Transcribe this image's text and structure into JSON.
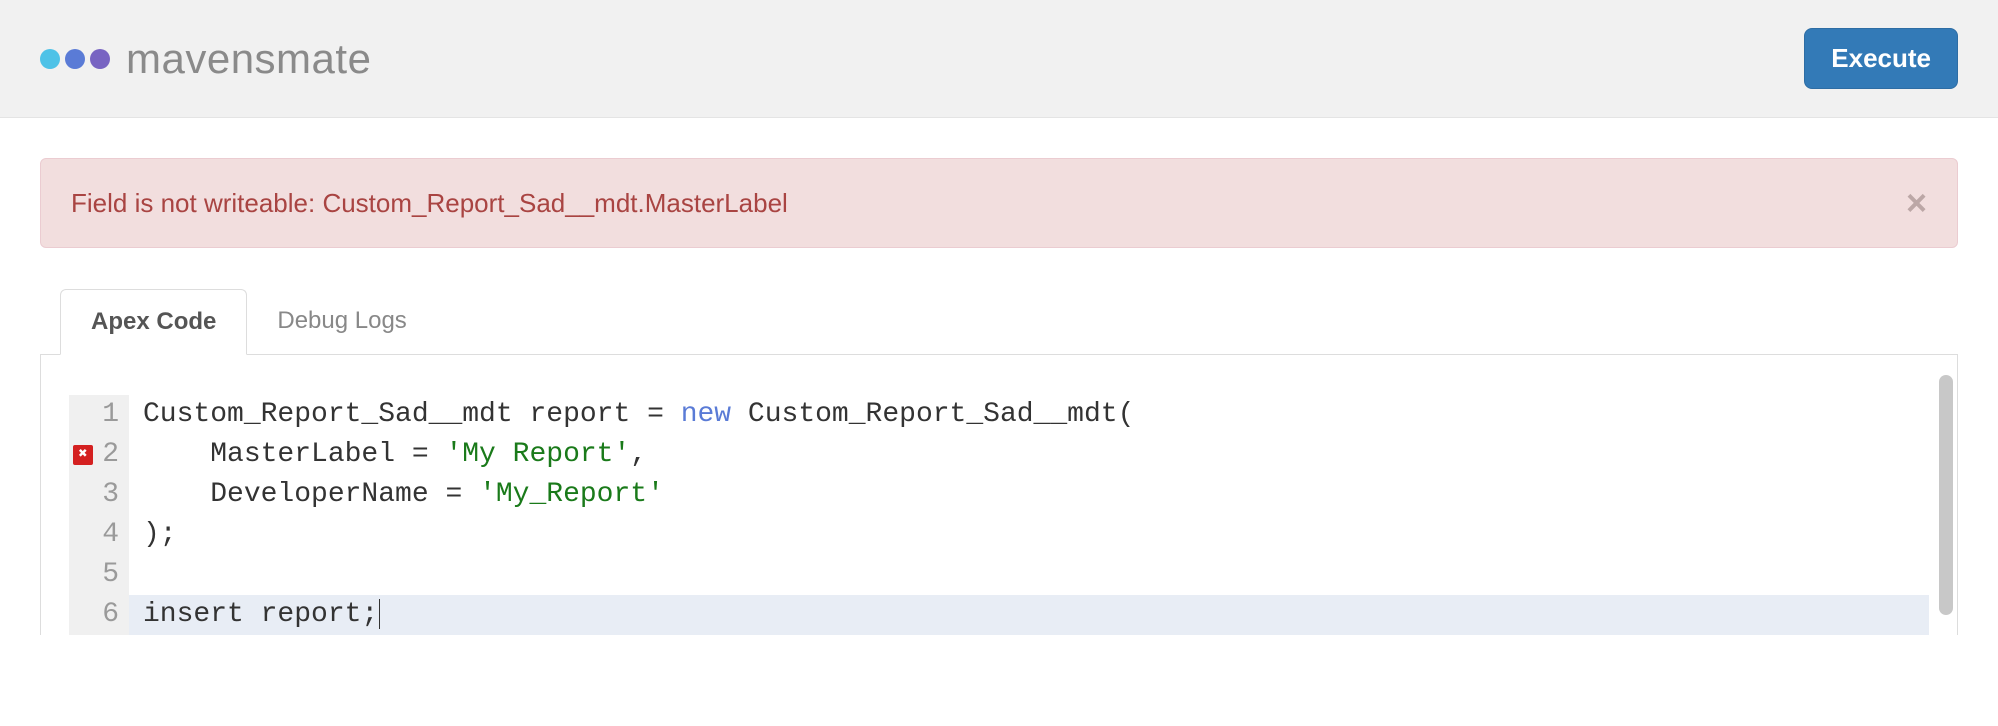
{
  "header": {
    "brand": "mavensmate",
    "execute_label": "Execute"
  },
  "alert": {
    "message": "Field is not writeable: Custom_Report_Sad__mdt.MasterLabel",
    "close_label": "×"
  },
  "tabs": {
    "apex_code": "Apex Code",
    "debug_logs": "Debug Logs"
  },
  "editor": {
    "error_line": 2,
    "active_line": 6,
    "lines": [
      {
        "n": 1,
        "tokens": [
          {
            "t": "Custom_Report_Sad__mdt report = ",
            "c": ""
          },
          {
            "t": "new",
            "c": "kw"
          },
          {
            "t": " Custom_Report_Sad__mdt(",
            "c": ""
          }
        ]
      },
      {
        "n": 2,
        "tokens": [
          {
            "t": "    MasterLabel = ",
            "c": ""
          },
          {
            "t": "'My Report'",
            "c": "str"
          },
          {
            "t": ",",
            "c": ""
          }
        ]
      },
      {
        "n": 3,
        "tokens": [
          {
            "t": "    DeveloperName = ",
            "c": ""
          },
          {
            "t": "'My_Report'",
            "c": "str"
          }
        ]
      },
      {
        "n": 4,
        "tokens": [
          {
            "t": ");",
            "c": ""
          }
        ]
      },
      {
        "n": 5,
        "tokens": [
          {
            "t": "",
            "c": ""
          }
        ]
      },
      {
        "n": 6,
        "tokens": [
          {
            "t": "insert report;",
            "c": ""
          }
        ]
      }
    ]
  }
}
